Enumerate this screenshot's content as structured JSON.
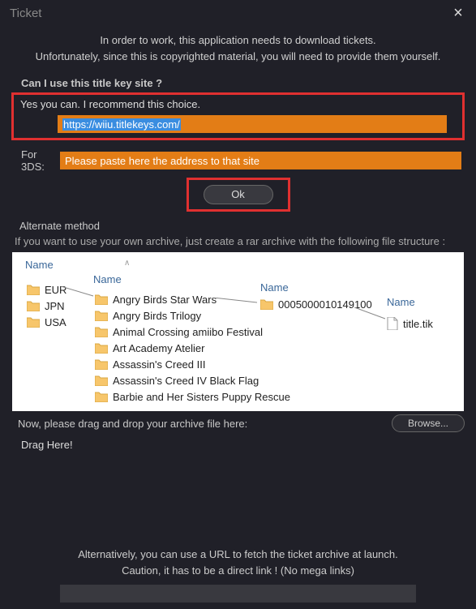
{
  "window": {
    "title": "Ticket"
  },
  "intro": {
    "line1": "In order to work, this application needs to download tickets.",
    "line2": "Unfortunately, since this is copyrighted material, you will need to provide them yourself."
  },
  "titlekey": {
    "question": "Can I use this title key site ?",
    "confirm": "Yes you can. I recommend this choice.",
    "url": "https://wiiu.titlekeys.com/",
    "for3ds_label": "For 3DS:",
    "for3ds_placeholder": "Please paste here the address to that site",
    "ok": "Ok"
  },
  "alternate": {
    "heading": "Alternate method",
    "desc": "If you want to use your own archive, just create a rar archive with the following file structure :",
    "col_name": "Name",
    "regions": [
      "EUR",
      "JPN",
      "USA"
    ],
    "games": [
      "Angry Birds Star Wars",
      "Angry Birds Trilogy",
      "Animal Crossing amiibo Festival",
      "Art Academy Atelier",
      "Assassin's Creed III",
      "Assassin's Creed IV Black Flag",
      "Barbie and Her Sisters Puppy Rescue"
    ],
    "title_id": "0005000010149100",
    "ticket_file": "title.tik",
    "drag_label": "Now, please drag and drop your archive file here:",
    "browse": "Browse...",
    "drag_here": "Drag Here!"
  },
  "urlfetch": {
    "line1": "Alternatively, you can use a URL to fetch the ticket archive at launch.",
    "line2": "Caution, it has to be a direct link ! (No mega links)"
  }
}
